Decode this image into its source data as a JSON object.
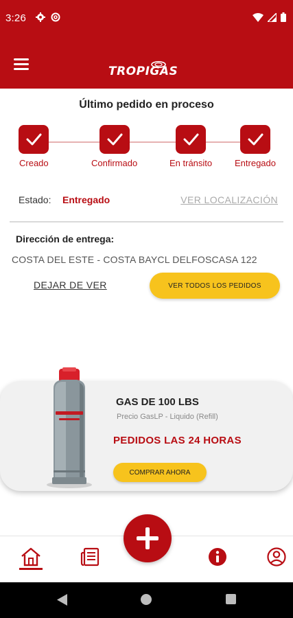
{
  "status_bar": {
    "time": "3:26",
    "icons": [
      "settings-gear-icon",
      "at-sign-icon",
      "wifi-icon",
      "signal-icon",
      "battery-icon"
    ]
  },
  "header": {
    "brand": "TROPIGAS",
    "menu_icon": "hamburger-menu-icon",
    "color": "#b80d13"
  },
  "order": {
    "title": "Último pedido en proceso",
    "steps": [
      {
        "label": "Creado",
        "done": true
      },
      {
        "label": "Confirmado",
        "done": true
      },
      {
        "label": "En tránsito",
        "done": true
      },
      {
        "label": "Entregado",
        "done": true
      }
    ],
    "status_label": "Estado:",
    "status_value": "Entregado",
    "view_location": "VER LOCALIZACIÓN",
    "address_label": "Dirección de entrega:",
    "address_value": "COSTA DEL ESTE - COSTA BAYCL DELFOSCASA 122",
    "stop_viewing": "DEJAR DE VER",
    "view_all": "VER TODOS LOS PEDIDOS"
  },
  "product": {
    "title": "GAS DE 100 LBS",
    "subtitle": "Precio GasLP - Liquido (Refill)",
    "promo": "PEDIDOS LAS 24 HORAS",
    "buy_button": "COMPRAR AHORA",
    "image": "gas-cylinder-image"
  },
  "bottom_nav": {
    "items": [
      "home-icon",
      "orders-document-icon",
      "add-order-button",
      "info-icon",
      "profile-icon"
    ],
    "active": "home-icon"
  },
  "colors": {
    "brand_red": "#b80d13",
    "accent_yellow": "#f7c31d"
  }
}
